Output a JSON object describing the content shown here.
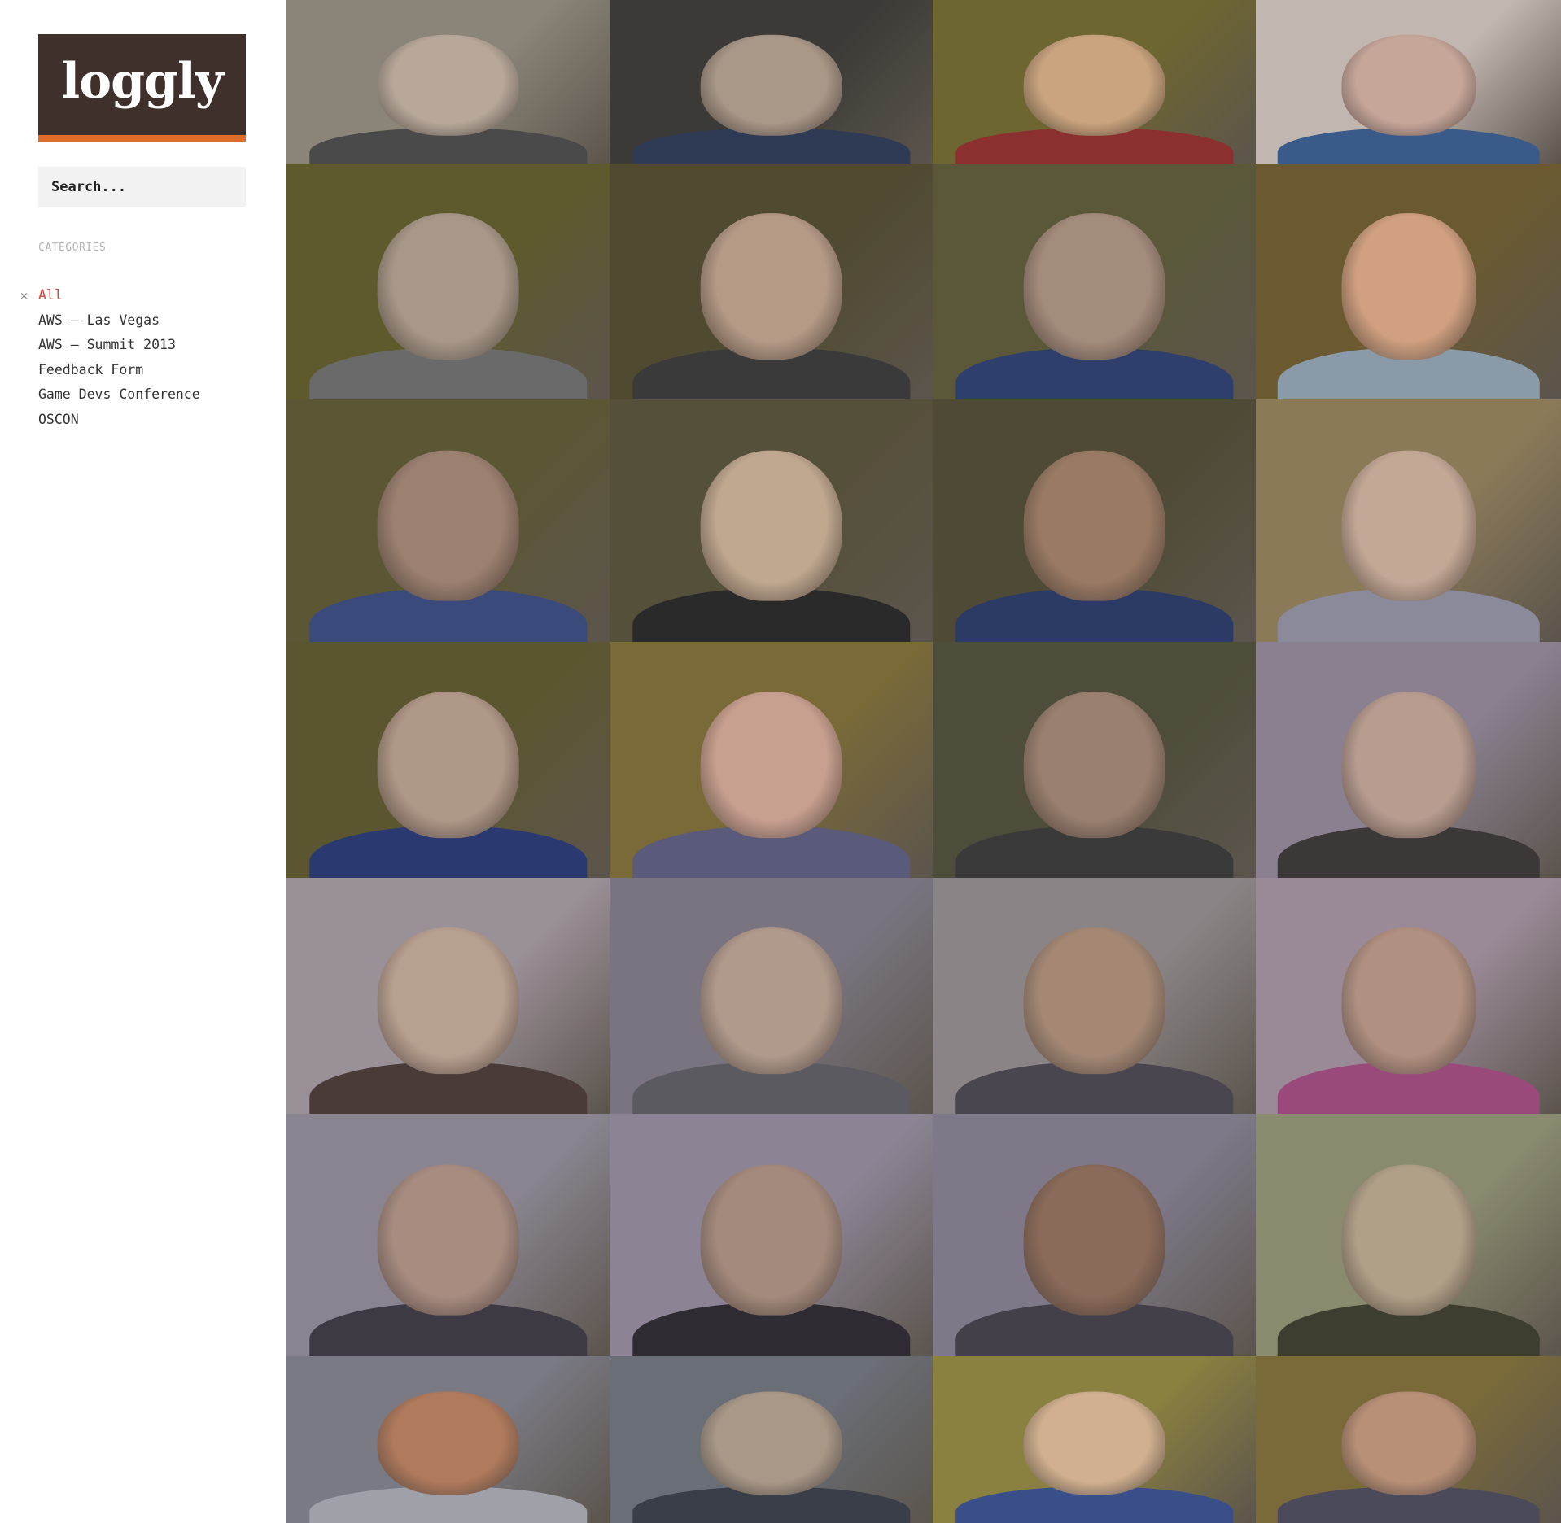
{
  "logo": {
    "text": "loggly"
  },
  "search": {
    "placeholder": "Search..."
  },
  "categories": {
    "heading": "CATEGORIES",
    "items": [
      {
        "label": "All",
        "active": true
      },
      {
        "label": "AWS — Las Vegas",
        "active": false
      },
      {
        "label": "AWS — Summit 2013",
        "active": false
      },
      {
        "label": "Feedback Form",
        "active": false
      },
      {
        "label": "Game Devs Conference",
        "active": false
      },
      {
        "label": "OSCON",
        "active": false
      }
    ]
  },
  "colors": {
    "logo_bg": "#3f302c",
    "logo_accent": "#e06c2a",
    "active_category": "#d9443e",
    "search_bg": "#f3f2f2"
  },
  "icons": {
    "clear_filter": "close-icon"
  },
  "photo_grid": {
    "columns": 4,
    "rows": 7,
    "tiles": [
      {
        "bg": "#8a8578",
        "skin": "#b7a89a",
        "shirt": "#4a4a4a"
      },
      {
        "bg": "#3c3a36",
        "skin": "#a99888",
        "shirt": "#2f3a55"
      },
      {
        "bg": "#6e6630",
        "skin": "#c9a47e",
        "shirt": "#8c2f2f"
      },
      {
        "bg": "#c2b7b0",
        "skin": "#c7a69a",
        "shirt": "#3a5a8a"
      },
      {
        "bg": "#5e5a2c",
        "skin": "#a8988a",
        "shirt": "#6a6a6a"
      },
      {
        "bg": "#4f4a30",
        "skin": "#b59a86",
        "shirt": "#3a3a3a"
      },
      {
        "bg": "#5a5838",
        "skin": "#a48c7c",
        "shirt": "#2e3f6e"
      },
      {
        "bg": "#6b5a30",
        "skin": "#d0a080",
        "shirt": "#8a9aa8"
      },
      {
        "bg": "#5b5734",
        "skin": "#9c8070",
        "shirt": "#3a4a7a"
      },
      {
        "bg": "#55503a",
        "skin": "#c0a890",
        "shirt": "#2a2a2a"
      },
      {
        "bg": "#4e4a35",
        "skin": "#9a7a64",
        "shirt": "#2c3a66"
      },
      {
        "bg": "#8a7a58",
        "skin": "#c4a896",
        "shirt": "#8a8a9a"
      },
      {
        "bg": "#5c5630",
        "skin": "#b09888",
        "shirt": "#2a3a70"
      },
      {
        "bg": "#7a6a38",
        "skin": "#c8a090",
        "shirt": "#5a5a7a"
      },
      {
        "bg": "#4e4c3a",
        "skin": "#9a8070",
        "shirt": "#3a3a3a"
      },
      {
        "bg": "#8a8090",
        "skin": "#b89c90",
        "shirt": "#3c3838"
      },
      {
        "bg": "#9a9098",
        "skin": "#b8a090",
        "shirt": "#4a3a38"
      },
      {
        "bg": "#7a7480",
        "skin": "#b09a8c",
        "shirt": "#5a5a60"
      },
      {
        "bg": "#8a8486",
        "skin": "#a48874",
        "shirt": "#4a4650"
      },
      {
        "bg": "#9a8a98",
        "skin": "#b09080",
        "shirt": "#9a4a7a"
      },
      {
        "bg": "#8a8490",
        "skin": "#a88c80",
        "shirt": "#3e3a44"
      },
      {
        "bg": "#8c8494",
        "skin": "#a48a7c",
        "shirt": "#2e2c32"
      },
      {
        "bg": "#7e7888",
        "skin": "#8a6a58",
        "shirt": "#44404a"
      },
      {
        "bg": "#8a8a6e",
        "skin": "#b0a088",
        "shirt": "#3e3e30"
      },
      {
        "bg": "#7a7a84",
        "skin": "#b07a5c",
        "shirt": "#a0a0a8"
      },
      {
        "bg": "#6a6e76",
        "skin": "#a89888",
        "shirt": "#3a3e48"
      },
      {
        "bg": "#8a8040",
        "skin": "#d0b090",
        "shirt": "#3a4e8a"
      },
      {
        "bg": "#7a6a3a",
        "skin": "#b89078",
        "shirt": "#4a4a5a"
      }
    ]
  }
}
